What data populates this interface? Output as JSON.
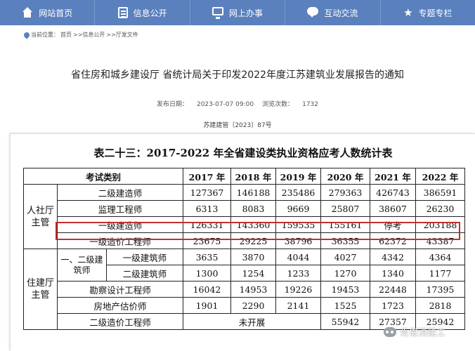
{
  "nav": {
    "items": [
      {
        "label": "网站首页",
        "icon": "home-icon"
      },
      {
        "label": "信息公开",
        "icon": "document-icon"
      },
      {
        "label": "网上办事",
        "icon": "monitor-icon"
      },
      {
        "label": "互动交流",
        "icon": "chat-icon"
      },
      {
        "label": "专题专栏",
        "icon": "star-icon"
      }
    ],
    "star_glyph": "★",
    "background": "#5a80bd"
  },
  "breadcrumb": {
    "prefix": "当前位置：",
    "items": [
      "首页",
      ">>信息公开",
      ">>厅发文件"
    ]
  },
  "article": {
    "title": "省住房和城乡建设厅 省统计局关于印发2022年度江苏建筑业发展报告的通知",
    "publish_label": "发布日期：",
    "publish_date": "2023-07-07 09:00",
    "views_label": "浏览次数：",
    "views": "1732",
    "doc_number": "苏建建管〔2023〕87号"
  },
  "table": {
    "title": "表二十三：2017-2022 年全省建设类执业资格应考人数统计表",
    "header_category": "考试类别",
    "years": [
      "2017 年",
      "2018 年",
      "2019 年",
      "2020 年",
      "2021 年",
      "2022 年"
    ],
    "group_hrss": "人社厅主管",
    "group_housing": "住建厅主管",
    "subgroup_architect": "一、二级建筑师",
    "not_held": "未开展",
    "rows": [
      {
        "name": "二级建造师",
        "values": [
          "127367",
          "146188",
          "235486",
          "279363",
          "426743",
          "386591"
        ]
      },
      {
        "name": "监理工程师",
        "values": [
          "6313",
          "8083",
          "9669",
          "25807",
          "38607",
          "26230"
        ]
      },
      {
        "name": "一级建造师",
        "values": [
          "126331",
          "143360",
          "159535",
          "155161",
          "停考",
          "203188"
        ]
      },
      {
        "name": "一级造价工程师",
        "values": [
          "23675",
          "29225",
          "38796",
          "36355",
          "62372",
          "43387"
        ]
      },
      {
        "name": "一级建筑师",
        "values": [
          "3635",
          "3870",
          "4044",
          "4027",
          "4342",
          "4364"
        ]
      },
      {
        "name": "二级建筑师",
        "values": [
          "1300",
          "1254",
          "1233",
          "1270",
          "1340",
          "1177"
        ]
      },
      {
        "name": "勘察设计工程师",
        "values": [
          "16042",
          "14953",
          "19226",
          "19453",
          "22448",
          "17395"
        ]
      },
      {
        "name": "房地产估价师",
        "values": [
          "1901",
          "2290",
          "2141",
          "1525",
          "1723",
          "2818"
        ]
      },
      {
        "name": "二级造价工程师",
        "values": [
          "",
          "",
          "",
          "55942",
          "27357",
          "25942"
        ]
      }
    ],
    "highlight_color": "#c0312e"
  },
  "watermark": {
    "text": "肯恩消建工"
  }
}
